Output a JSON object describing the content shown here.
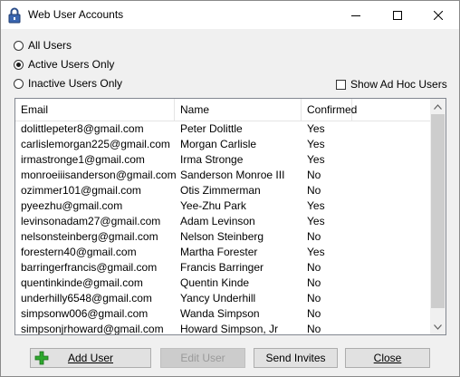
{
  "window": {
    "title": "Web User Accounts"
  },
  "filters": {
    "all_users": "All Users",
    "active_users": "Active Users Only",
    "inactive_users": "Inactive Users Only",
    "selected": "Active Users Only",
    "show_adhoc": "Show Ad Hoc Users",
    "show_adhoc_checked": false
  },
  "table": {
    "columns": [
      "Email",
      "Name",
      "Confirmed"
    ],
    "rows": [
      [
        "dolittlepeter8@gmail.com",
        "Peter Dolittle",
        "Yes"
      ],
      [
        "carlislemorgan225@gmail.com",
        "Morgan Carlisle",
        "Yes"
      ],
      [
        "irmastronge1@gmail.com",
        "Irma Stronge",
        "Yes"
      ],
      [
        "monroeiiisanderson@gmail.com",
        "Sanderson Monroe III",
        "No"
      ],
      [
        "ozimmer101@gmail.com",
        "Otis Zimmerman",
        "No"
      ],
      [
        "pyeezhu@gmail.com",
        "Yee-Zhu Park",
        "Yes"
      ],
      [
        "levinsonadam27@gmail.com",
        "Adam Levinson",
        "Yes"
      ],
      [
        "nelsonsteinberg@gmail.com",
        "Nelson Steinberg",
        "No"
      ],
      [
        "forestern40@gmail.com",
        "Martha Forester",
        "Yes"
      ],
      [
        "barringerfrancis@gmail.com",
        "Francis Barringer",
        "No"
      ],
      [
        "quentinkinde@gmail.com",
        "Quentin Kinde",
        "No"
      ],
      [
        "underhilly6548@gmail.com",
        "Yancy Underhill",
        "No"
      ],
      [
        "simpsonw006@gmail.com",
        "Wanda Simpson",
        "No"
      ],
      [
        "simpsonjrhoward@gmail.com",
        "Howard Simpson, Jr",
        "No"
      ]
    ]
  },
  "buttons": {
    "add_user": "Add User",
    "edit_user": "Edit User",
    "send_invites": "Send Invites",
    "close": "Close"
  },
  "icons": {
    "app": "padlock-icon",
    "add": "green-plus-icon"
  }
}
